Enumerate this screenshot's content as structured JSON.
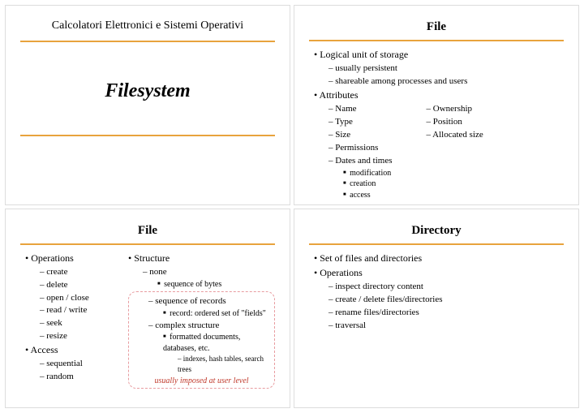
{
  "slide1": {
    "course": "Calcolatori Elettronici e Sistemi Operativi",
    "title": "Filesystem"
  },
  "slide2": {
    "title": "File",
    "b1": "Logical unit of storage",
    "b1a": "usually persistent",
    "b1b": "shareable among processes and users",
    "b2": "Attributes",
    "attrL1": "Name",
    "attrL2": "Type",
    "attrL3": "Size",
    "attrL4": "Permissions",
    "attrL5": "Dates and times",
    "attrL5a": "modification",
    "attrL5b": "creation",
    "attrL5c": "access",
    "attrR1": "Ownership",
    "attrR2": "Position",
    "attrR3": "Allocated size"
  },
  "slide3": {
    "title": "File",
    "ops": "Operations",
    "ops1": "create",
    "ops2": "delete",
    "ops3": "open / close",
    "ops4": "read / write",
    "ops5": "seek",
    "ops6": "resize",
    "acc": "Access",
    "acc1": "sequential",
    "acc2": "random",
    "struct": "Structure",
    "s1": "none",
    "s1a": "sequence of bytes",
    "s2": "sequence of records",
    "s2a": "record: ordered set of \"fields\"",
    "s3": "complex structure",
    "s3a": "formatted documents, databases, etc.",
    "s3a1": "indexes, hash tables, search trees",
    "note": "usually imposed at user level"
  },
  "slide4": {
    "title": "Directory",
    "b1": "Set of files and directories",
    "b2": "Operations",
    "b2a": "inspect directory content",
    "b2b": "create / delete files/directories",
    "b2c": "rename files/directories",
    "b2d": "traversal"
  }
}
